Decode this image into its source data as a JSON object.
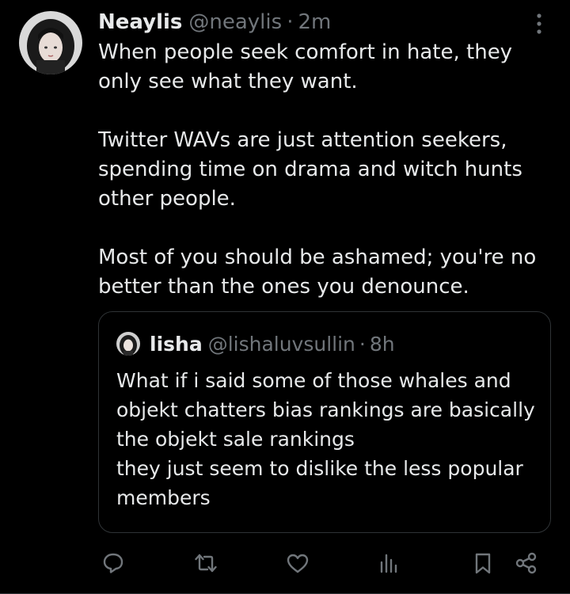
{
  "tweet": {
    "display_name": "Neaylis",
    "handle": "@neaylis",
    "separator": "·",
    "time": "2m",
    "paragraphs": [
      "When people seek comfort in hate, they only see what they want.",
      "Twitter WAVs are just attention seekers, spending time on drama and witch hunts other people.",
      "Most of you should be ashamed; you're no better than the ones you denounce."
    ]
  },
  "quote": {
    "display_name": "lisha",
    "handle": "@lishaluvsullin",
    "separator": "·",
    "time": "8h",
    "lines": [
      "What if i said some of those whales and objekt chatters bias rankings are basically the objekt sale rankings",
      "they just seem to dislike the less popular members"
    ]
  },
  "actions": [
    {
      "name": "reply-icon"
    },
    {
      "name": "retweet-icon"
    },
    {
      "name": "like-icon"
    },
    {
      "name": "views-icon"
    },
    {
      "name": "bookmark-icon"
    },
    {
      "name": "share-icon"
    }
  ],
  "colors": {
    "background": "#000000",
    "text": "#e7e9ea",
    "muted": "#71767b",
    "border": "#2f3336"
  }
}
